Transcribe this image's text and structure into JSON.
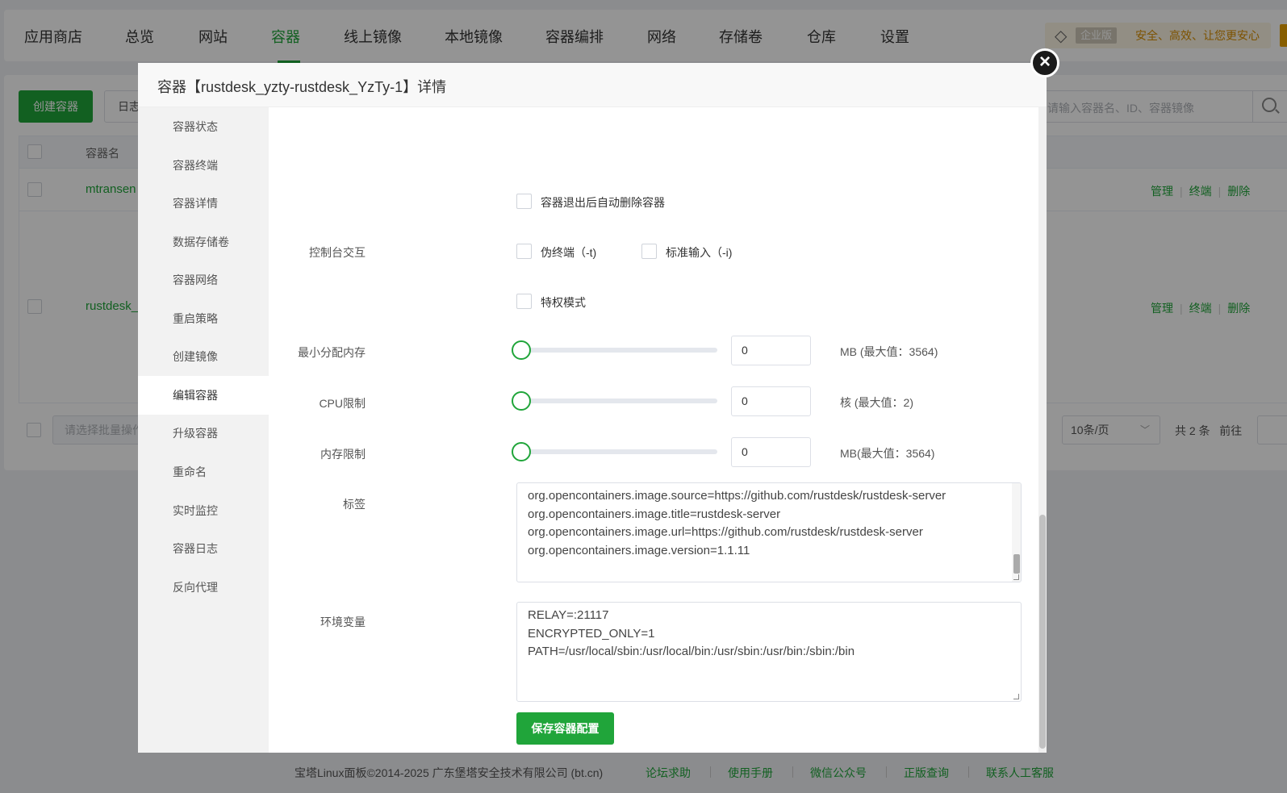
{
  "nav": {
    "tabs": [
      {
        "label": "应用商店"
      },
      {
        "label": "总览"
      },
      {
        "label": "网站"
      },
      {
        "label": "容器"
      },
      {
        "label": "线上镜像"
      },
      {
        "label": "本地镜像"
      },
      {
        "label": "容器编排"
      },
      {
        "label": "网络"
      },
      {
        "label": "存储卷"
      },
      {
        "label": "仓库"
      },
      {
        "label": "设置"
      }
    ],
    "active_tab": "容器",
    "enterprise_tag": "企业版",
    "enterprise_slogan": "安全、高效、让您更安心",
    "accent_color": "#20a53a"
  },
  "toolbar": {
    "create_label": "创建容器",
    "log_label": "日志",
    "search_placeholder": "请输入容器名、ID、容器镜像"
  },
  "table": {
    "header_name": "容器名",
    "rows": [
      {
        "name": "mtransen",
        "actions": [
          "管理",
          "终端",
          "删除"
        ]
      },
      {
        "name": "rustdesk_",
        "actions": [
          "管理",
          "终端",
          "删除"
        ]
      }
    ]
  },
  "pagination": {
    "batch_placeholder": "请选择批量操作",
    "page_size": "10条/页",
    "total": "共 2 条",
    "goto": "前往"
  },
  "footer": {
    "copyright": "宝塔Linux面板©2014-2025 广东堡塔安全技术有限公司 (bt.cn)",
    "links": [
      "论坛求助",
      "使用手册",
      "微信公众号",
      "正版查询",
      "联系人工客服"
    ]
  },
  "modal": {
    "title": "容器【rustdesk_yzty-rustdesk_YzTy-1】详情",
    "close_icon": "close-circle-icon",
    "sidebar": [
      {
        "label": "容器状态"
      },
      {
        "label": "容器终端"
      },
      {
        "label": "容器详情"
      },
      {
        "label": "数据存储卷"
      },
      {
        "label": "容器网络"
      },
      {
        "label": "重启策略"
      },
      {
        "label": "创建镜像"
      },
      {
        "label": "编辑容器"
      },
      {
        "label": "升级容器"
      },
      {
        "label": "重命名"
      },
      {
        "label": "实时监控"
      },
      {
        "label": "容器日志"
      },
      {
        "label": "反向代理"
      }
    ],
    "active_sidebar": "编辑容器",
    "form": {
      "auto_remove_label": "容器退出后自动删除容器",
      "auto_remove_checked": false,
      "console_label": "控制台交互",
      "tty_label": "伪终端（-t)",
      "tty_checked": false,
      "stdin_label": "标准输入（-i)",
      "stdin_checked": false,
      "privileged_label": "特权模式",
      "privileged_checked": false,
      "min_mem_label": "最小分配内存",
      "min_mem_value": "0",
      "min_mem_unit": "MB (最大值：3564)",
      "min_mem_slider_fraction": 0,
      "cpu_label": "CPU限制",
      "cpu_value": "0",
      "cpu_unit": "核 (最大值：2)",
      "cpu_slider_fraction": 0,
      "mem_limit_label": "内存限制",
      "mem_limit_value": "0",
      "mem_limit_unit": "MB(最大值：3564)",
      "mem_limit_slider_fraction": 0,
      "labels_label": "标签",
      "labels_lines": [
        "org.opencontainers.image.source=https://github.com/rustdesk/rustdesk-server",
        "org.opencontainers.image.title=rustdesk-server",
        "org.opencontainers.image.url=https://github.com/rustdesk/rustdesk-server",
        "org.opencontainers.image.version=1.1.11"
      ],
      "env_label": "环境变量",
      "env_lines": [
        "RELAY=:21117",
        "ENCRYPTED_ONLY=1",
        "PATH=/usr/local/sbin:/usr/local/bin:/usr/sbin:/usr/bin:/sbin:/bin"
      ],
      "save_label": "保存容器配置"
    }
  }
}
